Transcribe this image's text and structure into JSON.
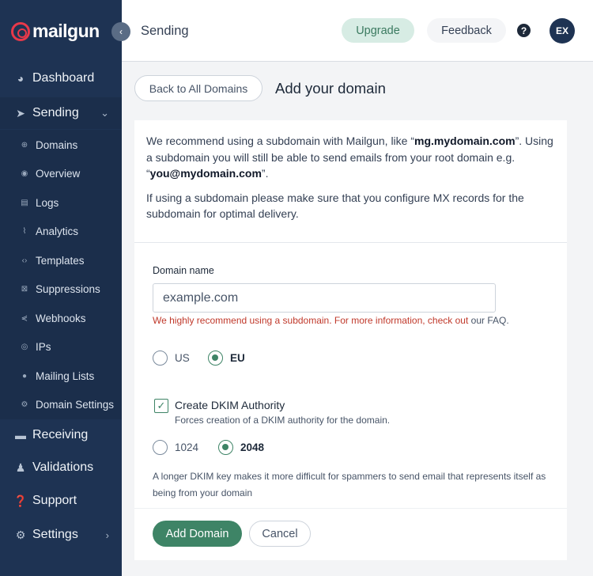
{
  "brand": {
    "logo_text": "mailgun",
    "accent_color": "#e8394a",
    "sidebar_color": "#1e3353"
  },
  "sidebar": {
    "collapse_icon": "chevron-left-icon",
    "main": [
      {
        "label": "Dashboard",
        "icon": "dashboard-icon"
      },
      {
        "label": "Sending",
        "icon": "send-icon",
        "active": true,
        "expanded": true
      },
      {
        "label": "Receiving",
        "icon": "inbox-icon"
      },
      {
        "label": "Validations",
        "icon": "user-check-icon"
      },
      {
        "label": "Support",
        "icon": "help-circle-icon"
      },
      {
        "label": "Settings",
        "icon": "gear-icon"
      }
    ],
    "sending_items": [
      {
        "label": "Domains",
        "icon": "globe-icon"
      },
      {
        "label": "Overview",
        "icon": "eye-icon"
      },
      {
        "label": "Logs",
        "icon": "file-icon"
      },
      {
        "label": "Analytics",
        "icon": "chart-line-icon"
      },
      {
        "label": "Templates",
        "icon": "code-icon"
      },
      {
        "label": "Suppressions",
        "icon": "block-icon"
      },
      {
        "label": "Webhooks",
        "icon": "webhook-icon"
      },
      {
        "label": "IPs",
        "icon": "location-icon"
      },
      {
        "label": "Mailing Lists",
        "icon": "user-icon"
      },
      {
        "label": "Domain Settings",
        "icon": "gear-icon"
      }
    ]
  },
  "header": {
    "title": "Sending",
    "upgrade_label": "Upgrade",
    "feedback_label": "Feedback",
    "help_label": "?",
    "avatar_initials": "EX"
  },
  "page": {
    "back_label": "Back to All Domains",
    "title": "Add your domain"
  },
  "intro": {
    "p1_a": "We recommend using a subdomain with Mailgun, like “",
    "p1_example": "mg.mydomain.com",
    "p1_b": "”. Using a subdomain you will still be able to send emails from your root domain e.g. “",
    "p1_email": "you@mydomain.com",
    "p1_c": "”.",
    "p2": "If using a subdomain please make sure that you configure MX records for the subdomain for optimal delivery."
  },
  "form": {
    "domain_label": "Domain name",
    "domain_placeholder": "example.com",
    "hint_text": "We highly recommend using a subdomain. For more information, check out ",
    "hint_link": "our FAQ.",
    "region_us": "US",
    "region_eu": "EU",
    "region_selected": "EU",
    "dkim_title": "Create DKIM Authority",
    "dkim_sub": "Forces creation of a DKIM authority for the domain.",
    "dkim_checked": true,
    "key_1024": "1024",
    "key_2048": "2048",
    "key_selected": "2048",
    "dkim_note": "A longer DKIM key makes it more difficult for spammers to send email that represents itself as being from your domain",
    "add_label": "Add Domain",
    "cancel_label": "Cancel"
  }
}
